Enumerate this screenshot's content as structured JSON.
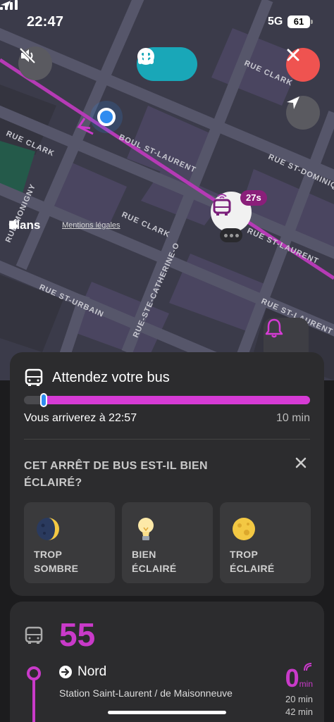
{
  "status": {
    "time": "22:47",
    "network": "5G",
    "battery": "61"
  },
  "map": {
    "apple_maps_label": "Plans",
    "legal_link": "Mentions légales",
    "streets": [
      "BOUL ST-LAURENT",
      "RUE CLARK",
      "RUE CLARK",
      "RUE ST-LAURENT",
      "RUE ST-URBAIN",
      "RUE-STE-CATHERINE-O",
      "RUE ST-DOMINIQUE",
      "RUE MONIGNY",
      "RUE CLARK",
      "RUE ST-LAURENT"
    ],
    "bus_eta_badge": "27s"
  },
  "trip": {
    "title": "Attendez votre bus",
    "arrival": "Vous arriverez à 22:57",
    "duration": "10 min",
    "progress": 0.07
  },
  "lighting": {
    "question": "CET ARRÊT DE BUS EST-IL BIEN ÉCLAIRÉ?",
    "options": [
      {
        "label": "TROP\nSOMBRE",
        "icon": "moon-icon"
      },
      {
        "label": "BIEN\nÉCLAIRÉ",
        "icon": "lightbulb-icon"
      },
      {
        "label": "TROP\nÉCLAIRÉ",
        "icon": "full-moon-icon"
      }
    ]
  },
  "departure": {
    "route": "55",
    "direction": "Nord",
    "stop": "Station Saint-Laurent / de Maisonneuve",
    "realtime_value": "0",
    "realtime_unit": "min",
    "next_1": "20 min",
    "next_2": "42 min"
  },
  "colors": {
    "accent": "#c93ac9",
    "teal": "#19a7b8",
    "close": "#ef5350",
    "user": "#2f8cf0"
  }
}
